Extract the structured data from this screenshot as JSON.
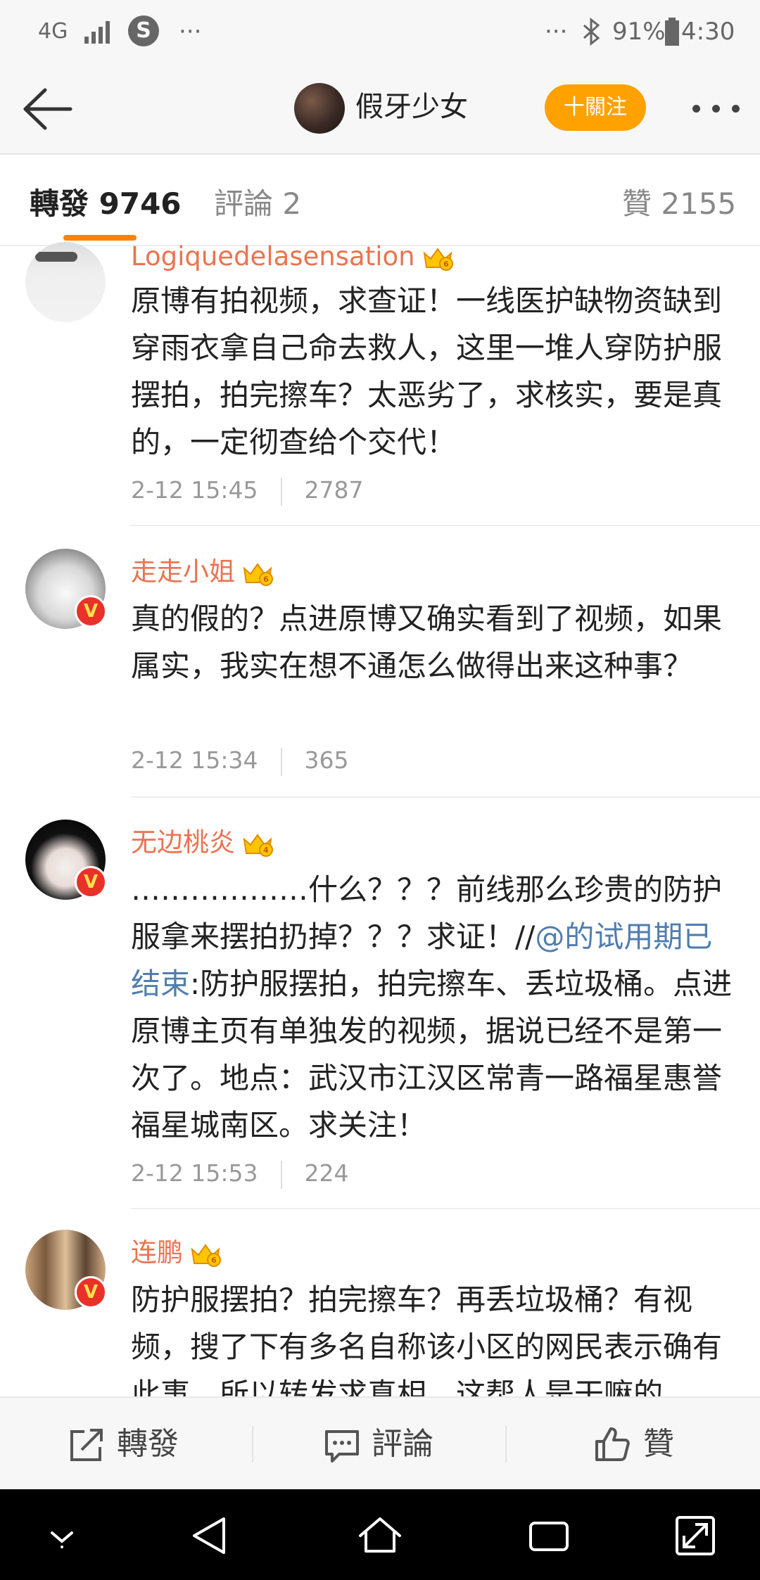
{
  "status_bar": {
    "network": "4G",
    "battery": "91%",
    "time": "4:30",
    "left_dots": "···",
    "right_dots": "···"
  },
  "header": {
    "title": "假牙少女",
    "follow_label": "十關注"
  },
  "tabs": {
    "repost": "轉發 9746",
    "comment": "評論 2",
    "like": "贊 2155"
  },
  "comments": [
    {
      "name": "Logiquedelasensation",
      "text": "原博有拍视频，求查证！一线医护缺物资缺到穿雨衣拿自己命去救人，这里一堆人穿防护服摆拍，拍完擦车？太恶劣了，求核实，要是真的，一定彻查给个交代！",
      "time": "2-12 15:45",
      "count": "2787"
    },
    {
      "name": "走走小姐",
      "text": "真的假的？点进原博又确实看到了视频，如果属实，我实在想不通怎么做得出来这种事？",
      "time": "2-12 15:34",
      "count": "365"
    },
    {
      "name": "无边桃炎",
      "text_before": "………………什么？？？前线那么珍贵的防护服拿来摆拍扔掉？？？求证！//",
      "mention": "@的试用期已结束",
      "text_after": ":防护服摆拍，拍完擦车、丢垃圾桶。点进原博主页有单独发的视频，据说已经不是第一次了。地点：武汉市江汉区常青一路福星惠誉福星城南区。求关注！",
      "time": "2-12 15:53",
      "count": "224"
    },
    {
      "name": "连鹏",
      "text": "防护服摆拍？拍完擦车？再丢垃圾桶？有视频，搜了下有多名自称该小区的网民表示确有此事，所以转发求真相，这帮人是干嘛的"
    }
  ],
  "toolbar": {
    "repost": "轉發",
    "comment": "評論",
    "like": "贊"
  },
  "colors": {
    "accent": "#ff8200",
    "follow_button": "#ffa200",
    "username": "#eb7350",
    "mention": "#507daf"
  },
  "icons": [
    "back-arrow-icon",
    "more-icon",
    "crown-icon",
    "verified-icon",
    "repost-icon",
    "comment-icon",
    "like-icon",
    "nav-down-icon",
    "nav-back-icon",
    "nav-home-icon",
    "nav-recents-icon",
    "nav-expand-icon"
  ]
}
